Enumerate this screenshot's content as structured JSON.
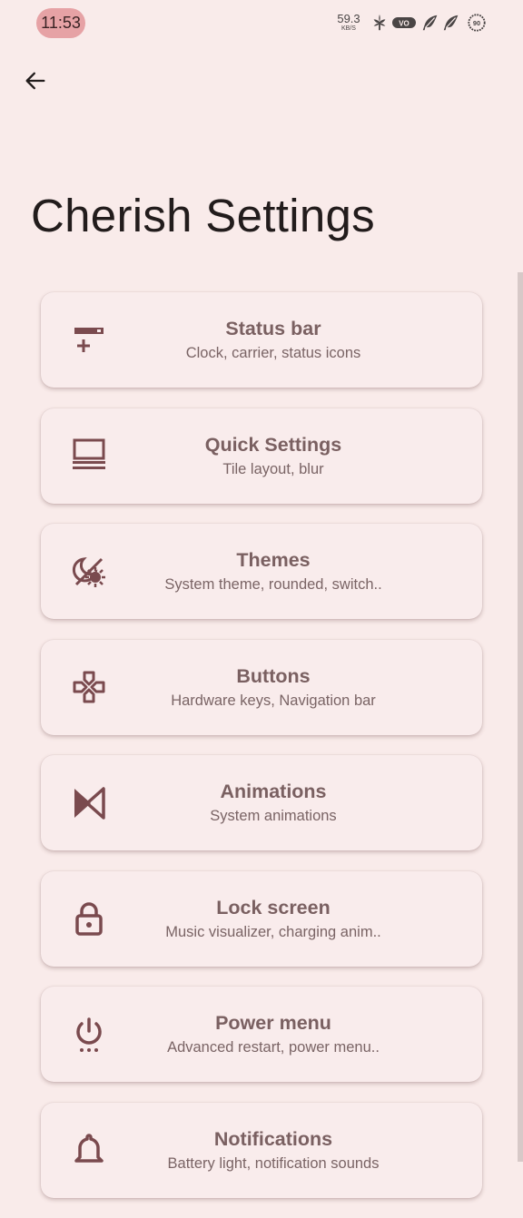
{
  "status_bar": {
    "time": "11:53",
    "net_speed_value": "59.3",
    "net_speed_unit": "KB/S",
    "battery_level": "90",
    "network_badge": "VO"
  },
  "header": {
    "title": "Cherish Settings"
  },
  "colors": {
    "background": "#f9ebea",
    "accent": "#7a4a4e",
    "card_text": "#7a6061"
  },
  "items": [
    {
      "title": "Status bar",
      "subtitle": "Clock, carrier, status icons",
      "icon": "statusbar-icon"
    },
    {
      "title": "Quick Settings",
      "subtitle": "Tile layout, blur",
      "icon": "quick-settings-icon"
    },
    {
      "title": "Themes",
      "subtitle": "System theme, rounded, switch..",
      "icon": "theme-icon"
    },
    {
      "title": "Buttons",
      "subtitle": "Hardware keys, Navigation bar",
      "icon": "gamepad-icon"
    },
    {
      "title": "Animations",
      "subtitle": "System animations",
      "icon": "animation-icon"
    },
    {
      "title": "Lock screen",
      "subtitle": "Music visualizer, charging anim..",
      "icon": "lock-icon"
    },
    {
      "title": "Power menu",
      "subtitle": "Advanced restart, power menu..",
      "icon": "power-icon"
    },
    {
      "title": "Notifications",
      "subtitle": "Battery light, notification sounds",
      "icon": "bell-icon"
    }
  ]
}
